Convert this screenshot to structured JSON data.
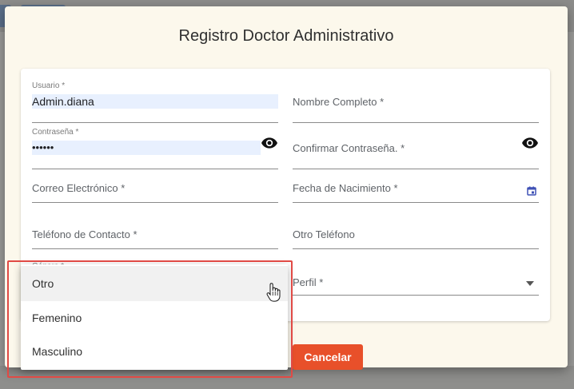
{
  "dialog": {
    "title": "Registro Doctor Administrativo"
  },
  "form": {
    "usuario": {
      "label": "Usuario *",
      "value": "Admin.diana"
    },
    "nombre_completo": {
      "placeholder": "Nombre Completo *"
    },
    "contrasena": {
      "label": "Contraseña *",
      "value": "••••••"
    },
    "confirmar_contrasena": {
      "placeholder": "Confirmar Contraseña. *"
    },
    "correo": {
      "placeholder": "Correo Electrónico *"
    },
    "fecha_nacimiento": {
      "placeholder": "Fecha de Nacimiento *"
    },
    "telefono_contacto": {
      "placeholder": "Teléfono de Contacto *"
    },
    "otro_telefono": {
      "placeholder": "Otro Teléfono"
    },
    "genero": {
      "label": "Género *"
    },
    "perfil": {
      "placeholder": "Perfil *"
    }
  },
  "genero_dropdown": {
    "options": [
      "Otro",
      "Femenino",
      "Masculino"
    ],
    "hovered_option": "Otro"
  },
  "actions": {
    "cancel_label": "Cancelar"
  },
  "icons": {
    "password_toggle": "eye-icon",
    "confirm_toggle": "eye-icon",
    "date_picker": "calendar-icon",
    "perfil_dropdown": "arrow-drop-down-icon",
    "pointer": "hand-pointer-icon"
  },
  "colors": {
    "dialog_bg": "#fcf8ec",
    "autofill_bg": "#e8f0fe",
    "cancel_button": "#e8502a",
    "highlight_border": "#e14a45",
    "date_icon": "#3f51b5"
  }
}
